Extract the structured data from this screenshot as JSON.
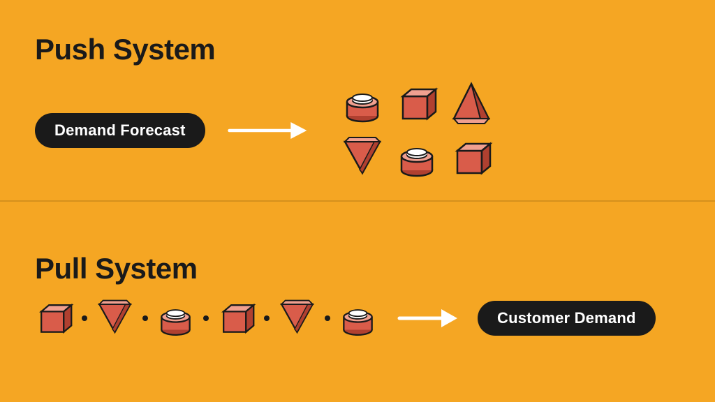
{
  "push_section": {
    "title": "Push System",
    "label": "Demand Forecast"
  },
  "pull_section": {
    "title": "Pull System",
    "label": "Customer Demand"
  },
  "colors": {
    "background": "#F5A623",
    "dark": "#1a1a1a",
    "white": "#ffffff",
    "shape_fill": "#D95C4A",
    "shape_stroke": "#1a1a1a",
    "shape_top": "#F0A090",
    "shape_side": "#B04030"
  }
}
